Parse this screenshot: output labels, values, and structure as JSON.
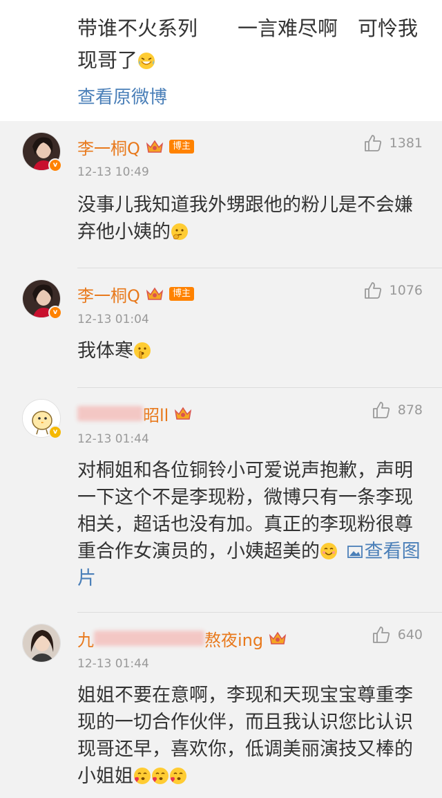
{
  "post": {
    "text": "带谁不火系列　　一言难尽啊　可怜我现哥了",
    "view_original": "查看原微博"
  },
  "comments": [
    {
      "name": "李一桐Q",
      "host_badge": "博主",
      "time": "12-13 10:49",
      "likes": "1381",
      "text": "没事儿我知道我外甥跟他的粉儿是不会嫌弃他小姨的"
    },
    {
      "name": "李一桐Q",
      "host_badge": "博主",
      "time": "12-13 01:04",
      "likes": "1076",
      "text": "我体寒"
    },
    {
      "name_visible": "昭ll",
      "time": "12-13 01:44",
      "likes": "878",
      "text": "对桐姐和各位铜铃小可爱说声抱歉，声明一下这个不是李现粉，微博只有一条李现相关，超话也没有加。真正的李现粉很尊重合作女演员的，小姨超美的",
      "view_pic": "查看图片"
    },
    {
      "name_prefix": "九",
      "name_visible": "熬夜ing",
      "time": "12-13 01:44",
      "likes": "640",
      "text": "姐姐不要在意啊，李现和天现宝宝尊重李现的一切合作伙伴，而且我认识您比认识现哥还早，喜欢你，低调美丽演技又棒的小姐姐"
    }
  ],
  "colors": {
    "name": "#e8791c",
    "link": "#4a7fb8",
    "badge": "#ff8200",
    "meta": "#999999"
  }
}
